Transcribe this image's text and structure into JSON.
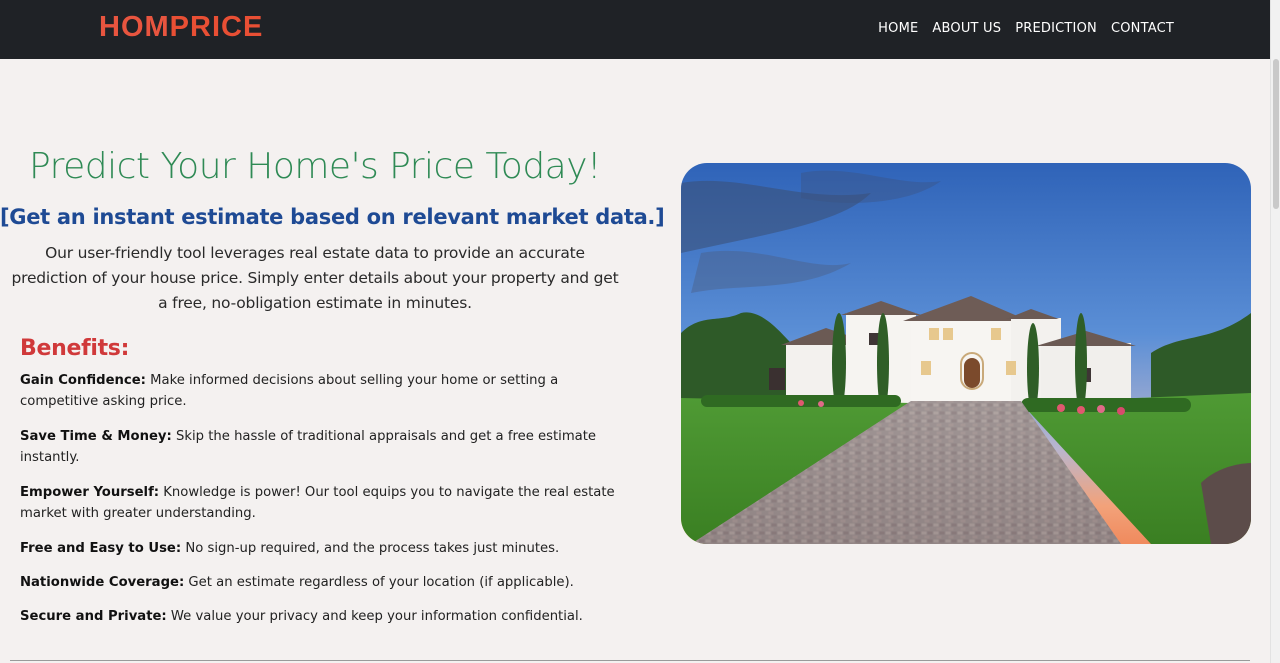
{
  "brand": {
    "logo_a": "HOM",
    "logo_b": "PRICE"
  },
  "nav": {
    "items": [
      "HOME",
      "ABOUT US",
      "PREDICTION",
      "CONTACT"
    ]
  },
  "hero": {
    "title": "Predict Your Home's Price Today!",
    "subtitle": "[Get an instant estimate based on relevant market data.]",
    "description": "Our user-friendly tool leverages real estate data to provide an accurate prediction of your house price. Simply enter details about your property and get a free, no-obligation estimate in minutes."
  },
  "benefits": {
    "title": "Benefits:",
    "items": [
      {
        "label": "Gain Confidence:",
        "text": " Make informed decisions about selling your home or setting a competitive asking price."
      },
      {
        "label": "Save Time & Money:",
        "text": " Skip the hassle of traditional appraisals and get a free estimate instantly."
      },
      {
        "label": "Empower Yourself:",
        "text": " Knowledge is power! Our tool equips you to navigate the real estate market with greater understanding."
      },
      {
        "label": "Free and Easy to Use:",
        "text": " No sign-up required, and the process takes just minutes."
      },
      {
        "label": "Nationwide Coverage:",
        "text": " Get an estimate regardless of your location (if applicable)."
      },
      {
        "label": "Secure and Private:",
        "text": " We value your privacy and keep your information confidential."
      }
    ]
  },
  "colors": {
    "nav_bg": "#1f2226",
    "logo": "#e8553f",
    "title_green": "#2f8a55",
    "subtitle_blue": "#1e4a94",
    "benefits_red": "#d0393a",
    "page_bg": "#f4f1f0"
  }
}
